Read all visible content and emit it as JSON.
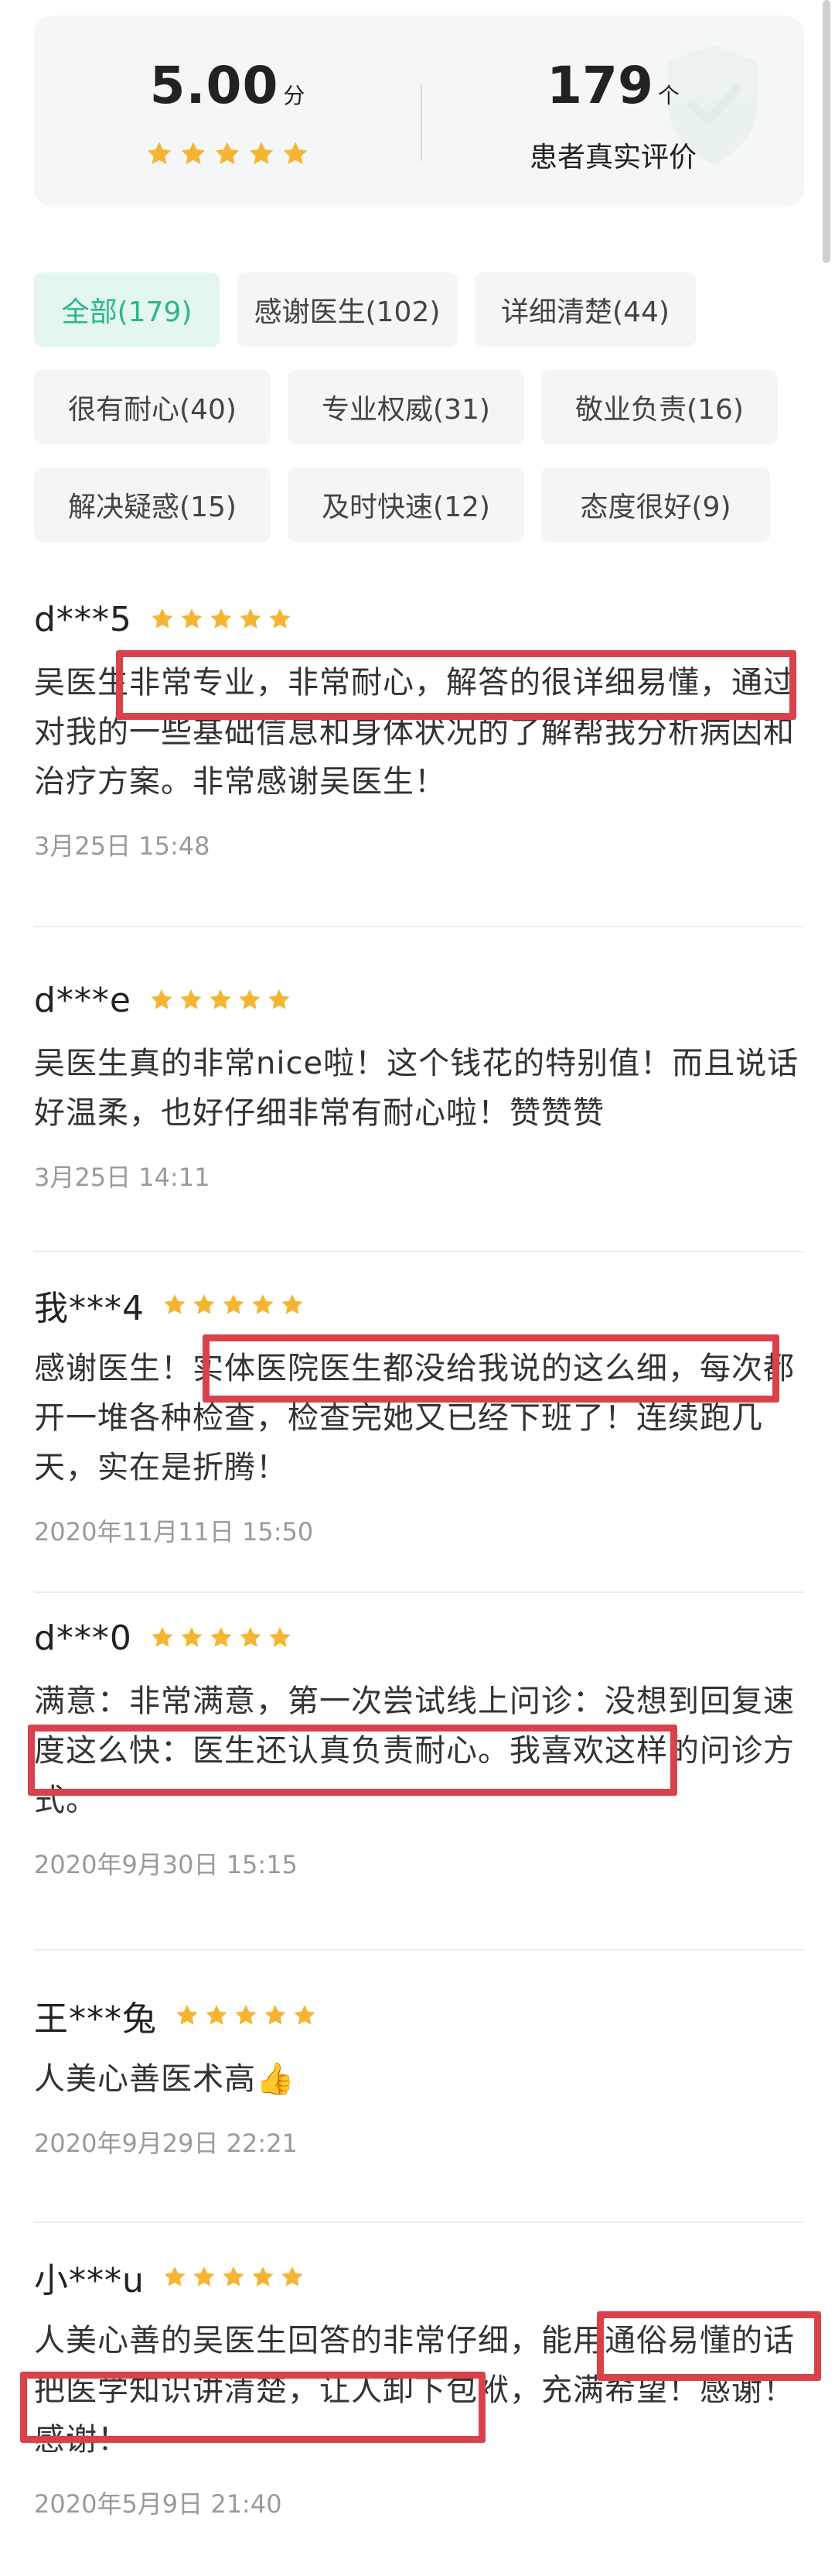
{
  "summary": {
    "score": "5.00",
    "score_unit": "分",
    "count": "179",
    "count_unit": "个",
    "count_label": "患者真实评价",
    "rating_stars": 5
  },
  "tags": [
    {
      "label": "全部(179)",
      "active": true
    },
    {
      "label": "感谢医生(102)",
      "active": false
    },
    {
      "label": "详细清楚(44)",
      "active": false
    },
    {
      "label": "很有耐心(40)",
      "active": false
    },
    {
      "label": "专业权威(31)",
      "active": false
    },
    {
      "label": "敬业负责(16)",
      "active": false
    },
    {
      "label": "解决疑惑(15)",
      "active": false
    },
    {
      "label": "及时快速(12)",
      "active": false
    },
    {
      "label": "态度很好(9)",
      "active": false
    }
  ],
  "reviews": [
    {
      "user": "d***5",
      "stars": 5,
      "text": "吴医生非常专业，非常耐心，解答的很详细易懂，通过对我的一些基础信息和身体状况的了解帮我分析病因和治疗方案。非常感谢吴医生！",
      "time": "3月25日 15:48"
    },
    {
      "user": "d***e",
      "stars": 5,
      "text": "吴医生真的非常nice啦！这个钱花的特别值！而且说话好温柔，也好仔细非常有耐心啦！赞赞赞",
      "time": "3月25日 14:11"
    },
    {
      "user": "我***4",
      "stars": 5,
      "text": "感谢医生！实体医院医生都没给我说的这么细，每次都开一堆各种检查，检查完她又已经下班了！连续跑几天，实在是折腾！",
      "time": "2020年11月11日 15:50"
    },
    {
      "user": "d***0",
      "stars": 5,
      "text": "满意：非常满意，第一次尝试线上问诊：没想到回复速度这么快：医生还认真负责耐心。我喜欢这样的问诊方式。",
      "time": "2020年9月30日 15:15"
    },
    {
      "user": "王***兔",
      "stars": 5,
      "text": "人美心善医术高👍",
      "time": "2020年9月29日 22:21"
    },
    {
      "user": "小***u",
      "stars": 5,
      "text": "人美心善的吴医生回答的非常仔细，能用通俗易懂的话把医学知识讲清楚，让人卸下包袱，充满希望！感谢！感谢！",
      "time": "2020年5月9日 21:40"
    }
  ],
  "colors": {
    "accent_green": "#2bb68a",
    "star_gold": "#f5b533",
    "highlight_red": "#d9424b"
  },
  "icons": {
    "star": "star-icon",
    "watermark": "shield-check-icon"
  }
}
